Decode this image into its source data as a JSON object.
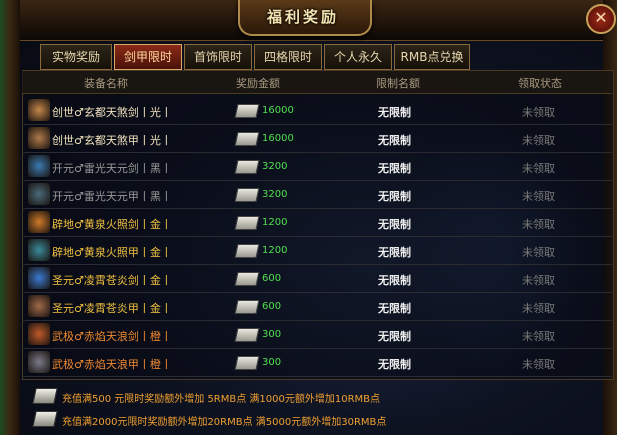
{
  "window": {
    "title": "福利奖励",
    "close_label": "✕"
  },
  "tabs": [
    {
      "label": "实物奖励",
      "active": false
    },
    {
      "label": "剑甲限时",
      "active": true
    },
    {
      "label": "首饰限时",
      "active": false
    },
    {
      "label": "四格限时",
      "active": false
    },
    {
      "label": "个人永久",
      "active": false
    },
    {
      "label": "RMB点兑换",
      "active": false
    }
  ],
  "columns": {
    "name": "装备名称",
    "amount": "奖励金额",
    "limit": "限制名额",
    "status": "领取状态"
  },
  "rows": [
    {
      "name": "创世♂玄都天煞剑丨光丨",
      "amount": "16000",
      "limit": "无限制",
      "status": "未领取",
      "name_color": "#f4e3c0",
      "icon_color": "#c4874a",
      "icon": "sword-icon"
    },
    {
      "name": "创世♂玄都天煞甲丨光丨",
      "amount": "16000",
      "limit": "无限制",
      "status": "未领取",
      "name_color": "#f4e3c0",
      "icon_color": "#b07a4a",
      "icon": "armor-icon"
    },
    {
      "name": "开元♂雷光天元剑丨黑丨",
      "amount": "3200",
      "limit": "无限制",
      "status": "未领取",
      "name_color": "#9a9a9a",
      "icon_color": "#3a7ab0",
      "icon": "sword-icon"
    },
    {
      "name": "开元♂雷光天元甲丨黑丨",
      "amount": "3200",
      "limit": "无限制",
      "status": "未领取",
      "name_color": "#9a9a9a",
      "icon_color": "#4a6a7a",
      "icon": "armor-icon"
    },
    {
      "name": "辟地♂黄泉火照剑丨金丨",
      "amount": "1200",
      "limit": "无限制",
      "status": "未领取",
      "name_color": "#f0c040",
      "icon_color": "#d07a2a",
      "icon": "sword-icon"
    },
    {
      "name": "辟地♂黄泉火照甲丨金丨",
      "amount": "1200",
      "limit": "无限制",
      "status": "未领取",
      "name_color": "#f0c040",
      "icon_color": "#3a8a9a",
      "icon": "armor-icon"
    },
    {
      "name": "圣元♂凌霄苍炎剑丨金丨",
      "amount": "600",
      "limit": "无限制",
      "status": "未领取",
      "name_color": "#f0c040",
      "icon_color": "#3a7ad0",
      "icon": "sword-icon"
    },
    {
      "name": "圣元♂凌霄苍炎甲丨金丨",
      "amount": "600",
      "limit": "无限制",
      "status": "未领取",
      "name_color": "#f0c040",
      "icon_color": "#a06a4a",
      "icon": "armor-icon"
    },
    {
      "name": "武极♂赤焰天浪剑丨橙丨",
      "amount": "300",
      "limit": "无限制",
      "status": "未领取",
      "name_color": "#f08a30",
      "icon_color": "#c05a2a",
      "icon": "sword-icon"
    },
    {
      "name": "武极♂赤焰天浪甲丨橙丨",
      "amount": "300",
      "limit": "无限制",
      "status": "未领取",
      "name_color": "#f08a30",
      "icon_color": "#7a7a8a",
      "icon": "armor-icon"
    }
  ],
  "footer": [
    {
      "text": "充值满500 元限时奖励额外增加 5RMB点   满1000元额外增加10RMB点"
    },
    {
      "text": "充值满2000元限时奖励额外增加20RMB点   满5000元额外增加30RMB点"
    }
  ],
  "colors": {
    "accent_gold": "#c9a25a",
    "active_tab": "#8a2a18",
    "amount_green": "#4fe04f",
    "footer_orange": "#f0a030"
  }
}
